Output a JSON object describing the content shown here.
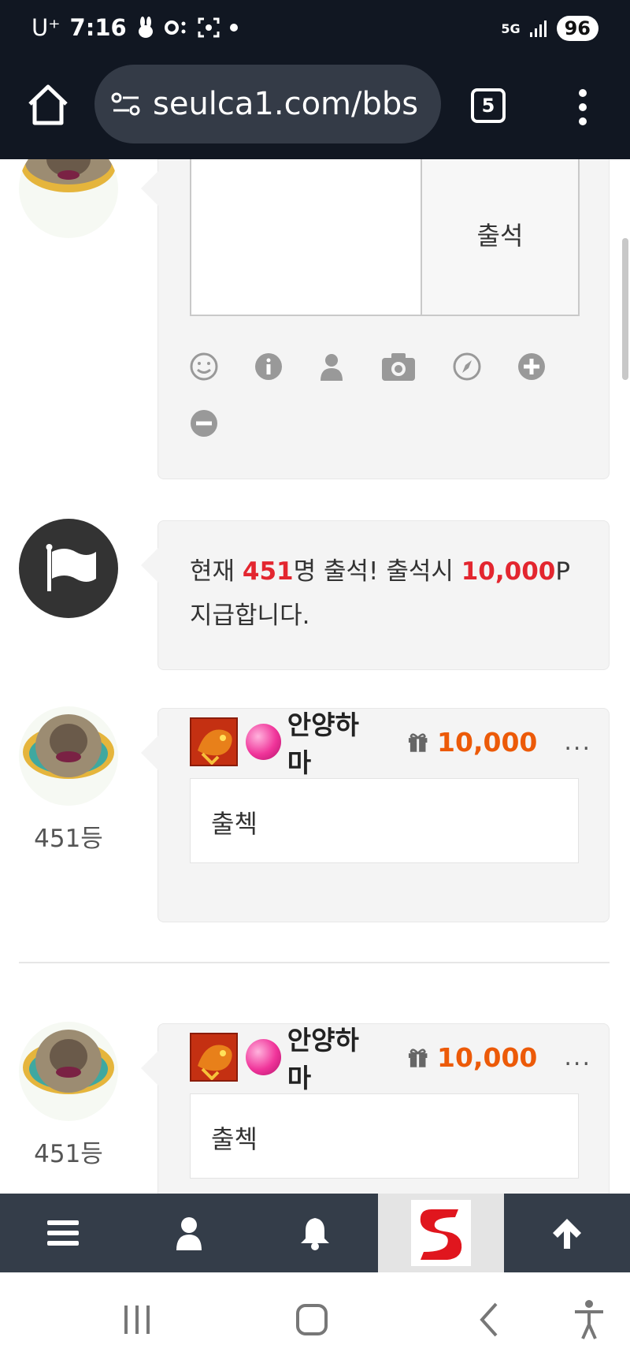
{
  "status_bar": {
    "carrier": "U⁺",
    "time": "7:16",
    "network": "5G",
    "battery": "96"
  },
  "browser": {
    "url": "seulca1.com/bbs",
    "tab_count": "5"
  },
  "attendance_form": {
    "textarea_value": "",
    "submit_label": "출석",
    "tools": [
      "emoji-icon",
      "info-icon",
      "user-icon",
      "camera-icon",
      "compass-icon",
      "plus-circle-icon",
      "minus-circle-icon"
    ]
  },
  "notice": {
    "prefix": "현재 ",
    "count": "451",
    "middle": "명 출석! 출석시 ",
    "points": "10,000",
    "suffix": "P 지급합니다."
  },
  "comments": [
    {
      "rank": "451등",
      "nickname": "안양하마",
      "points": "10,000",
      "more": "...",
      "text": "출첵"
    },
    {
      "rank": "451등",
      "nickname": "안양하마",
      "points": "10,000",
      "more": "...",
      "text": "출첵"
    }
  ],
  "bottom_nav": [
    "menu-icon",
    "user-icon",
    "bell-icon",
    "site-logo",
    "arrow-up-icon"
  ],
  "colors": {
    "accent_red": "#e3262f",
    "points_orange": "#ec5a08",
    "header_bg": "#111722",
    "nav_bg": "#343d49"
  }
}
